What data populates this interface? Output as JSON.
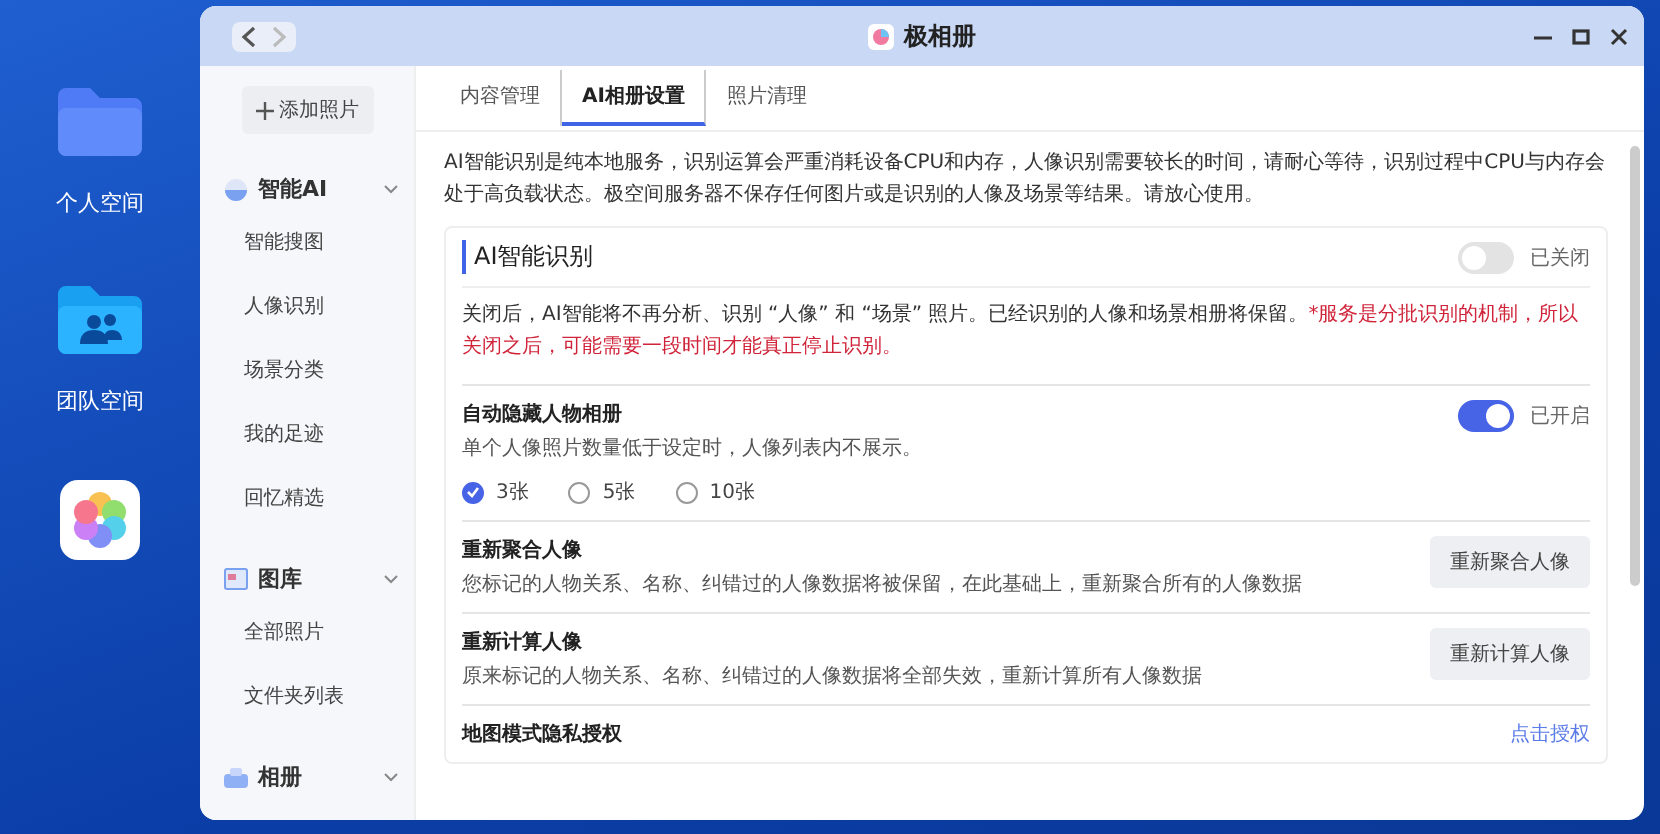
{
  "desktop": {
    "icons": [
      {
        "kind": "folder",
        "label": "个人空间"
      },
      {
        "kind": "team",
        "label": "团队空间"
      },
      {
        "kind": "photos"
      }
    ]
  },
  "window": {
    "title": "极相册"
  },
  "sidebar": {
    "add_button": "添加照片",
    "sections": [
      {
        "kind": "ai",
        "title": "智能AI",
        "items": [
          "智能搜图",
          "人像识别",
          "场景分类",
          "我的足迹",
          "回忆精选"
        ]
      },
      {
        "kind": "gallery",
        "title": "图库",
        "items": [
          "全部照片",
          "文件夹列表"
        ]
      },
      {
        "kind": "album",
        "title": "相册"
      }
    ]
  },
  "tabs": [
    {
      "label": "内容管理",
      "selected": false
    },
    {
      "label": "AI相册设置",
      "selected": true
    },
    {
      "label": "照片清理",
      "selected": false
    }
  ],
  "intro": "AI智能识别是纯本地服务，识别运算会严重消耗设备CPU和内存，人像识别需要较长的时间，请耐心等待，识别过程中CPU与内存会处于高负载状态。极空间服务器不保存任何图片或是识别的人像及场景等结果。请放心使用。",
  "section": {
    "title": "AI智能识别",
    "on": false,
    "state_label": "已关闭",
    "notice": "关闭后，AI智能将不再分析、识别 “人像” 和 “场景” 照片。已经识别的人像和场景相册将保留。",
    "warning": "*服务是分批识别的机制，所以关闭之后，可能需要一段时间才能真正停止识别。"
  },
  "settings": [
    {
      "kind": "toggle",
      "title": "自动隐藏人物相册",
      "description": "单个人像照片数量低于设定时，人像列表内不展示。",
      "on": true,
      "state_label": "已开启",
      "options": [
        {
          "label": "3张",
          "selected": true
        },
        {
          "label": "5张",
          "selected": false
        },
        {
          "label": "10张",
          "selected": false
        }
      ]
    },
    {
      "kind": "button",
      "title": "重新聚合人像",
      "description": "您标记的人物关系、名称、纠错过的人像数据将被保留，在此基础上，重新聚合所有的人像数据",
      "button": "重新聚合人像"
    },
    {
      "kind": "button",
      "title": "重新计算人像",
      "description": "原来标记的人物关系、名称、纠错过的人像数据将全部失效，重新计算所有人像数据",
      "button": "重新计算人像"
    },
    {
      "kind": "link",
      "title": "地图模式隐私授权",
      "link": "点击授权"
    }
  ]
}
